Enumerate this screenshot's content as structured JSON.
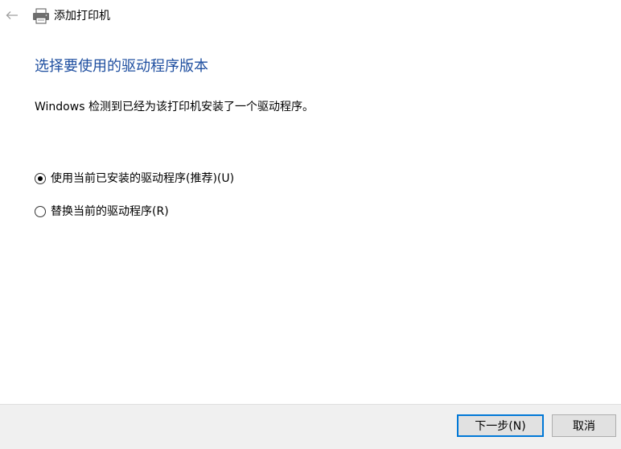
{
  "window": {
    "title": "添加打印机",
    "back_icon": "arrow-left-icon",
    "app_icon": "printer-icon"
  },
  "content": {
    "heading": "选择要使用的驱动程序版本",
    "description": "Windows 检测到已经为该打印机安装了一个驱动程序。",
    "options": [
      {
        "label": "使用当前已安装的驱动程序(推荐)(U)",
        "selected": true
      },
      {
        "label": "替换当前的驱动程序(R)",
        "selected": false
      }
    ]
  },
  "footer": {
    "next_label": "下一步(N)",
    "cancel_label": "取消"
  },
  "colors": {
    "heading": "#1f4fa0",
    "focus_border": "#0078d7",
    "footer_bg": "#f0f0f0"
  }
}
